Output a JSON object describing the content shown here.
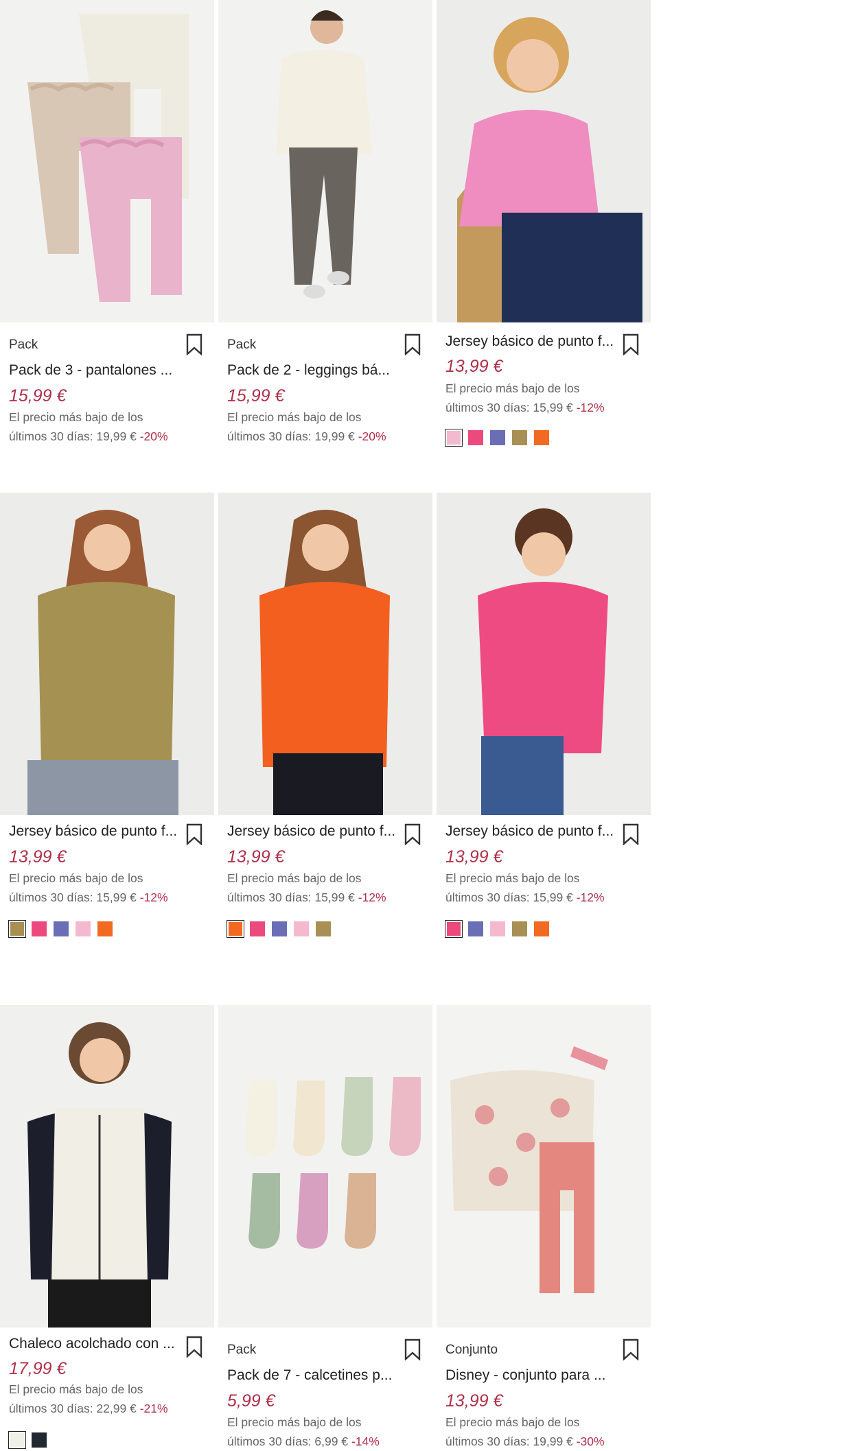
{
  "products": [
    {
      "label": "Pack",
      "title": "Pack de 3 - pantalones ...",
      "price": "15,99 €",
      "lowest_prefix": "El precio más bajo de los",
      "lowest_line2": "últimos 30 días: 19,99 €",
      "discount": "-20%",
      "swatches": []
    },
    {
      "label": "Pack",
      "title": "Pack de 2 - leggings bá...",
      "price": "15,99 €",
      "lowest_prefix": "El precio más bajo de los",
      "lowest_line2": "últimos 30 días: 19,99 €",
      "discount": "-20%",
      "swatches": []
    },
    {
      "label": "",
      "title": "Jersey básico de punto f...",
      "price": "13,99 €",
      "lowest_prefix": "El precio más bajo de los",
      "lowest_line2": "últimos 30 días: 15,99 €",
      "discount": "-12%",
      "swatches": [
        "#f4b8cf",
        "#ec4a7c",
        "#6a6eb5",
        "#a89055",
        "#f26a22"
      ]
    },
    {
      "label": "",
      "title": "Jersey básico de punto f...",
      "price": "13,99 €",
      "lowest_prefix": "El precio más bajo de los",
      "lowest_line2": "últimos 30 días: 15,99 €",
      "discount": "-12%",
      "swatches": [
        "#a89055",
        "#ec4a7c",
        "#6a6eb5",
        "#f4b8cf",
        "#f26a22"
      ]
    },
    {
      "label": "",
      "title": "Jersey básico de punto f...",
      "price": "13,99 €",
      "lowest_prefix": "El precio más bajo de los",
      "lowest_line2": "últimos 30 días: 15,99 €",
      "discount": "-12%",
      "swatches": [
        "#f26a22",
        "#ec4a7c",
        "#6a6eb5",
        "#f4b8cf",
        "#a89055"
      ]
    },
    {
      "label": "",
      "title": "Jersey básico de punto f...",
      "price": "13,99 €",
      "lowest_prefix": "El precio más bajo de los",
      "lowest_line2": "últimos 30 días: 15,99 €",
      "discount": "-12%",
      "swatches": [
        "#ec4a7c",
        "#6a6eb5",
        "#f4b8cf",
        "#a89055",
        "#f26a22"
      ]
    },
    {
      "label": "",
      "title": "Chaleco acolchado con ...",
      "price": "17,99 €",
      "lowest_prefix": "El precio más bajo de los",
      "lowest_line2": "últimos 30 días: 22,99 €",
      "discount": "-21%",
      "swatches": [
        "#f0efe9",
        "#222831"
      ]
    },
    {
      "label": "Pack",
      "title": "Pack de 7 - calcetines p...",
      "price": "5,99 €",
      "lowest_prefix": "El precio más bajo de los",
      "lowest_line2": "últimos 30 días: 6,99 €",
      "discount": "-14%",
      "swatches": []
    },
    {
      "label": "Conjunto",
      "title": "Disney - conjunto para ...",
      "price": "13,99 €",
      "lowest_prefix": "El precio más bajo de los",
      "lowest_line2": "últimos 30 días: 19,99 €",
      "discount": "-30%",
      "swatches": []
    }
  ],
  "colors": {
    "price": "#b0304a",
    "card_bg": "#efefed"
  },
  "icons": {
    "bookmark": "bookmark-icon"
  }
}
